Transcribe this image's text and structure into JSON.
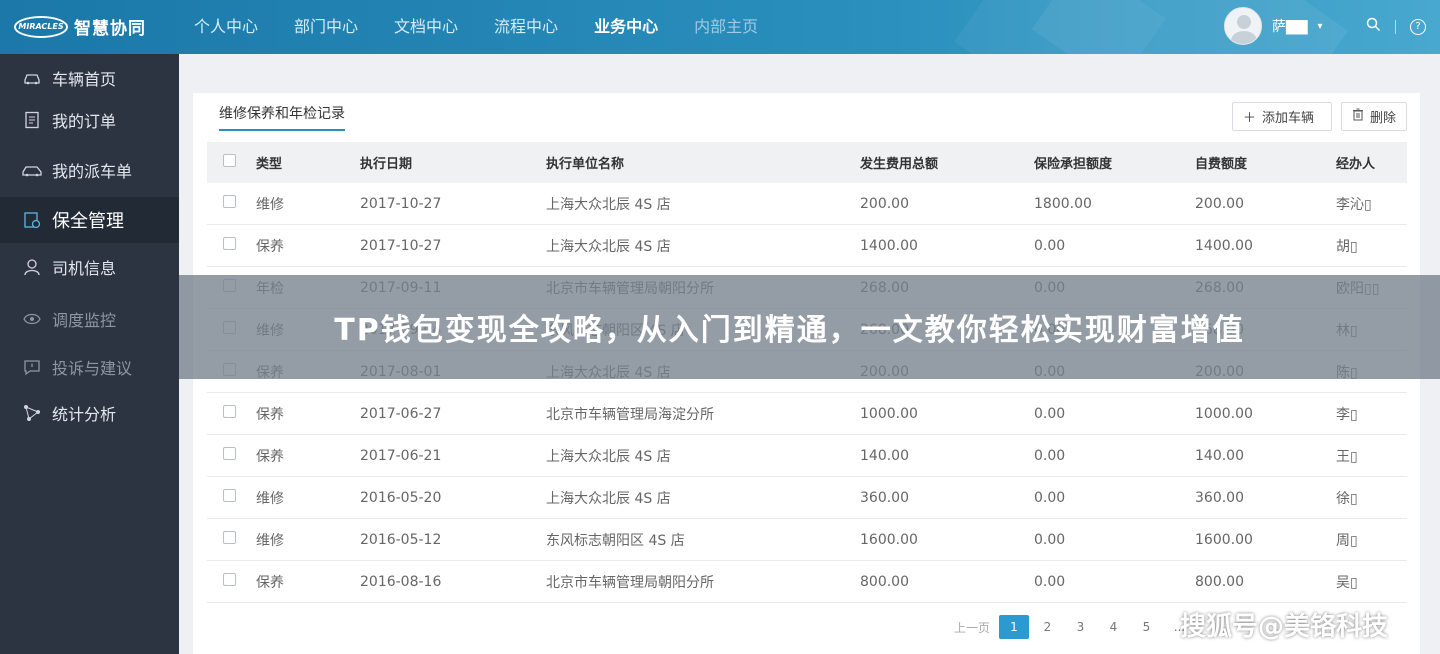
{
  "app": {
    "logo_mark": "MIRACLES",
    "logo_text": "智慧协同",
    "nav": [
      "个人中心",
      "部门中心",
      "文档中心",
      "流程中心",
      "业务中心",
      "内部主页"
    ],
    "user_name": "萨▇▇"
  },
  "sidebar": {
    "items": [
      {
        "label": "车辆首页",
        "icon": "car-icon"
      },
      {
        "label": "我的订单",
        "icon": "order-icon"
      },
      {
        "label": "我的派车单",
        "icon": "dispatch-car-icon"
      },
      {
        "label": "保全管理",
        "icon": "shield-icon"
      },
      {
        "label": "司机信息",
        "icon": "driver-icon"
      },
      {
        "label": "调度监控",
        "icon": "monitor-icon"
      },
      {
        "label": "投诉与建议",
        "icon": "feedback-icon"
      },
      {
        "label": "统计分析",
        "icon": "stats-icon"
      }
    ]
  },
  "panel": {
    "tab": "维修保养和年检记录",
    "add_label": "添加车辆",
    "delete_label": "删除",
    "columns": [
      "类型",
      "执行日期",
      "执行单位名称",
      "发生费用总额",
      "保险承担额度",
      "自费额度",
      "经办人"
    ],
    "rows": [
      [
        "维修",
        "2017-10-27",
        "上海大众北辰 4S 店",
        "200.00",
        "1800.00",
        "200.00",
        "李沁▯"
      ],
      [
        "保养",
        "2017-10-27",
        "上海大众北辰 4S 店",
        "1400.00",
        "0.00",
        "1400.00",
        "胡▯"
      ],
      [
        "年检",
        "2017-09-11",
        "北京市车辆管理局朝阳分所",
        "268.00",
        "0.00",
        "268.00",
        "欧阳▯▯"
      ],
      [
        "维修",
        "2017-09-04",
        "东风标志朝阳区 4S 店",
        "268.00",
        "0.00",
        "268.00",
        "林▯"
      ],
      [
        "保养",
        "2017-08-01",
        "上海大众北辰 4S 店",
        "200.00",
        "0.00",
        "200.00",
        "陈▯"
      ],
      [
        "保养",
        "2017-06-27",
        "北京市车辆管理局海淀分所",
        "1000.00",
        "0.00",
        "1000.00",
        "李▯"
      ],
      [
        "保养",
        "2017-06-21",
        "上海大众北辰 4S 店",
        "140.00",
        "0.00",
        "140.00",
        "王▯"
      ],
      [
        "维修",
        "2016-05-20",
        "上海大众北辰 4S 店",
        "360.00",
        "0.00",
        "360.00",
        "徐▯"
      ],
      [
        "维修",
        "2016-05-12",
        "东风标志朝阳区 4S 店",
        "1600.00",
        "0.00",
        "1600.00",
        "周▯"
      ],
      [
        "保养",
        "2016-08-16",
        "北京市车辆管理局朝阳分所",
        "800.00",
        "0.00",
        "800.00",
        "吴▯"
      ]
    ],
    "pager": {
      "prev": "上一页",
      "pages": [
        "1",
        "2",
        "3",
        "4",
        "5",
        "..."
      ]
    }
  },
  "overlay": {
    "banner": "TP钱包变现全攻略，从入门到精通，一文教你轻松实现财富增值",
    "watermark": "搜狐号@美铬科技"
  }
}
